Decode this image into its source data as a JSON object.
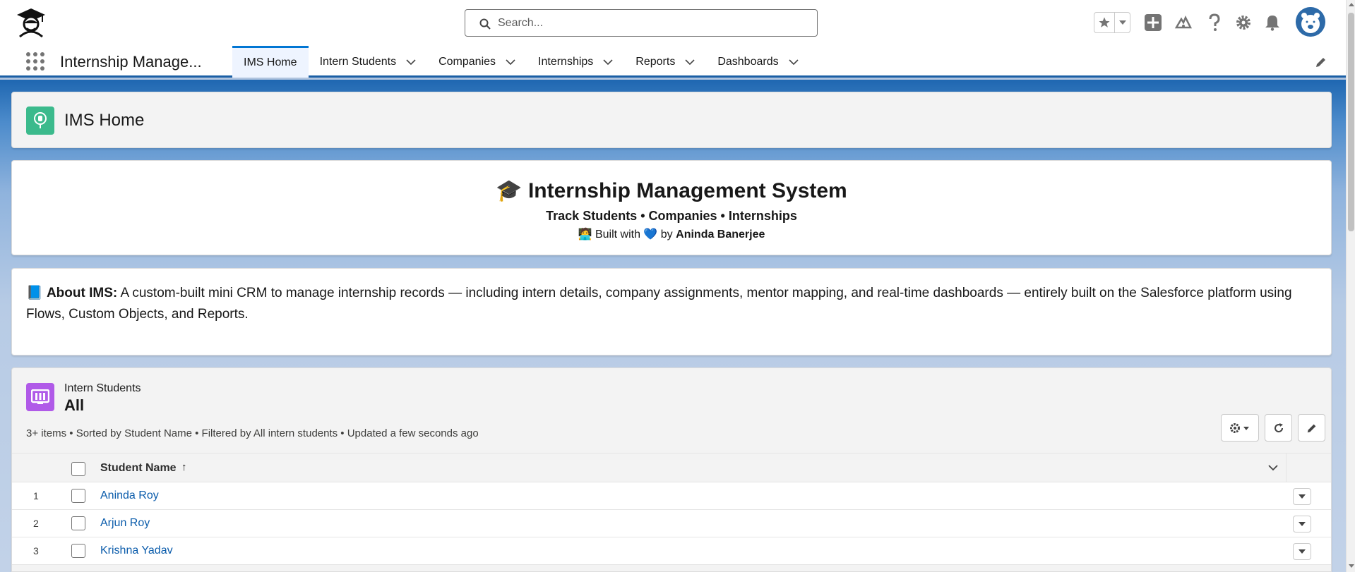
{
  "header": {
    "search_placeholder": "Search..."
  },
  "nav": {
    "app_name": "Internship Manage...",
    "tabs": [
      {
        "label": "IMS Home",
        "active": true,
        "has_menu": false
      },
      {
        "label": "Intern Students",
        "active": false,
        "has_menu": true
      },
      {
        "label": "Companies",
        "active": false,
        "has_menu": true
      },
      {
        "label": "Internships",
        "active": false,
        "has_menu": true
      },
      {
        "label": "Reports",
        "active": false,
        "has_menu": true
      },
      {
        "label": "Dashboards",
        "active": false,
        "has_menu": true
      }
    ]
  },
  "page": {
    "title": "IMS Home"
  },
  "banner": {
    "title_emoji": "🎓",
    "title": "Internship Management System",
    "subtitle": "Track Students • Companies • Internships",
    "built_prefix": "🧑‍💻 Built with 💙 by",
    "author": "Aninda Banerjee"
  },
  "about": {
    "emoji": "📘",
    "label": "About IMS:",
    "text": "A custom-built mini CRM to manage internship records — including intern details, company assignments, mentor mapping, and real-time dashboards — entirely built on the Salesforce platform using Flows, Custom Objects, and Reports."
  },
  "list": {
    "object_name": "Intern Students",
    "view_name": "All",
    "meta": "3+ items • Sorted by Student Name • Filtered by All intern students • Updated a few seconds ago",
    "column_header": "Student Name",
    "sort_arrow": "↑",
    "rows": [
      {
        "num": "1",
        "name": "Aninda Roy"
      },
      {
        "num": "2",
        "name": "Arjun Roy"
      },
      {
        "num": "3",
        "name": "Krishna Yadav"
      }
    ]
  },
  "colors": {
    "brand_blue": "#0176d3",
    "link_blue": "#0b5cab",
    "page_icon_green": "#3bba8c",
    "list_icon_purple": "#b05ae8"
  }
}
